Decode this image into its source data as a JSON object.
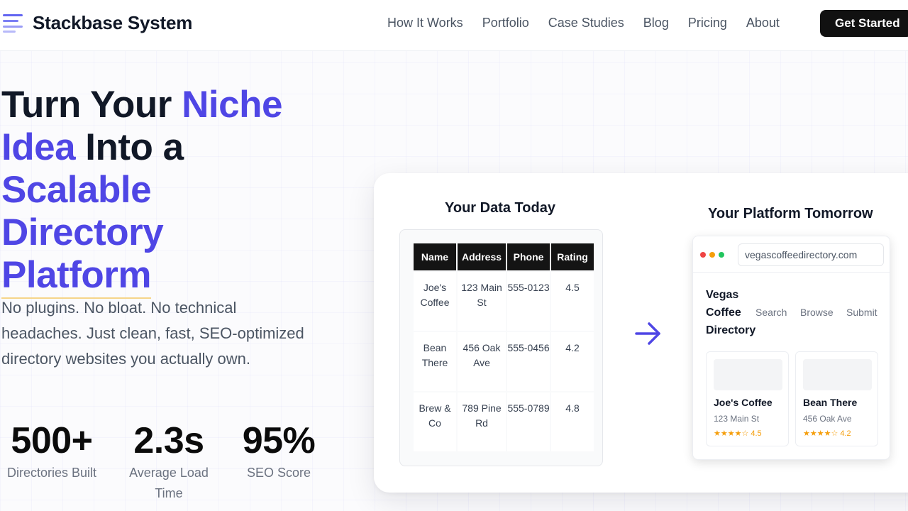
{
  "header": {
    "brand": "Stackbase System",
    "nav": [
      "How It Works",
      "Portfolio",
      "Case Studies",
      "Blog",
      "Pricing",
      "About"
    ],
    "cta_label": "Get Started"
  },
  "hero": {
    "title_line1_a": "Turn Your ",
    "title_line1_b": "Niche",
    "title_line2_a": "Idea",
    "title_line2_b": " Into a",
    "title_line3": "Scalable",
    "title_line4": "Directory",
    "title_line5": "Platform",
    "subtitle": "No plugins. No bloat. No technical headaches. Just clean, fast, SEO-optimized directory websites you actually own."
  },
  "stats": [
    {
      "value": "500+",
      "label": "Directories Built"
    },
    {
      "value": "2.3s",
      "label": "Average Load Time"
    },
    {
      "value": "95%",
      "label": "SEO Score"
    }
  ],
  "showcase": {
    "left_title": "Your Data Today",
    "right_title": "Your Platform Tomorrow",
    "table": {
      "headers": [
        "Name",
        "Address",
        "Phone",
        "Rating"
      ],
      "rows": [
        [
          "Joe's Coffee",
          "123 Main St",
          "555-0123",
          "4.5"
        ],
        [
          "Bean There",
          "456 Oak Ave",
          "555-0456",
          "4.2"
        ],
        [
          "Brew & Co",
          "789 Pine Rd",
          "555-0789",
          "4.8"
        ]
      ]
    },
    "browser": {
      "url": "vegascoffeedirectory.com",
      "site_title": "Vegas Coffee Directory",
      "site_nav": [
        "Search",
        "Browse",
        "Submit"
      ],
      "listings": [
        {
          "name": "Joe's Coffee",
          "address": "123 Main St",
          "rating": "★★★★☆ 4.5"
        },
        {
          "name": "Bean There",
          "address": "456 Oak Ave",
          "rating": "★★★★☆ 4.2"
        }
      ]
    }
  },
  "colors": {
    "accent": "#4f46e5",
    "cta_bg": "#111111",
    "star": "#f59e0b",
    "dot_red": "#ef4444",
    "dot_yellow": "#f59e0b",
    "dot_green": "#22c55e"
  },
  "icons": {
    "logo": "stacked-lines-icon",
    "arrow": "arrow-right-icon"
  }
}
